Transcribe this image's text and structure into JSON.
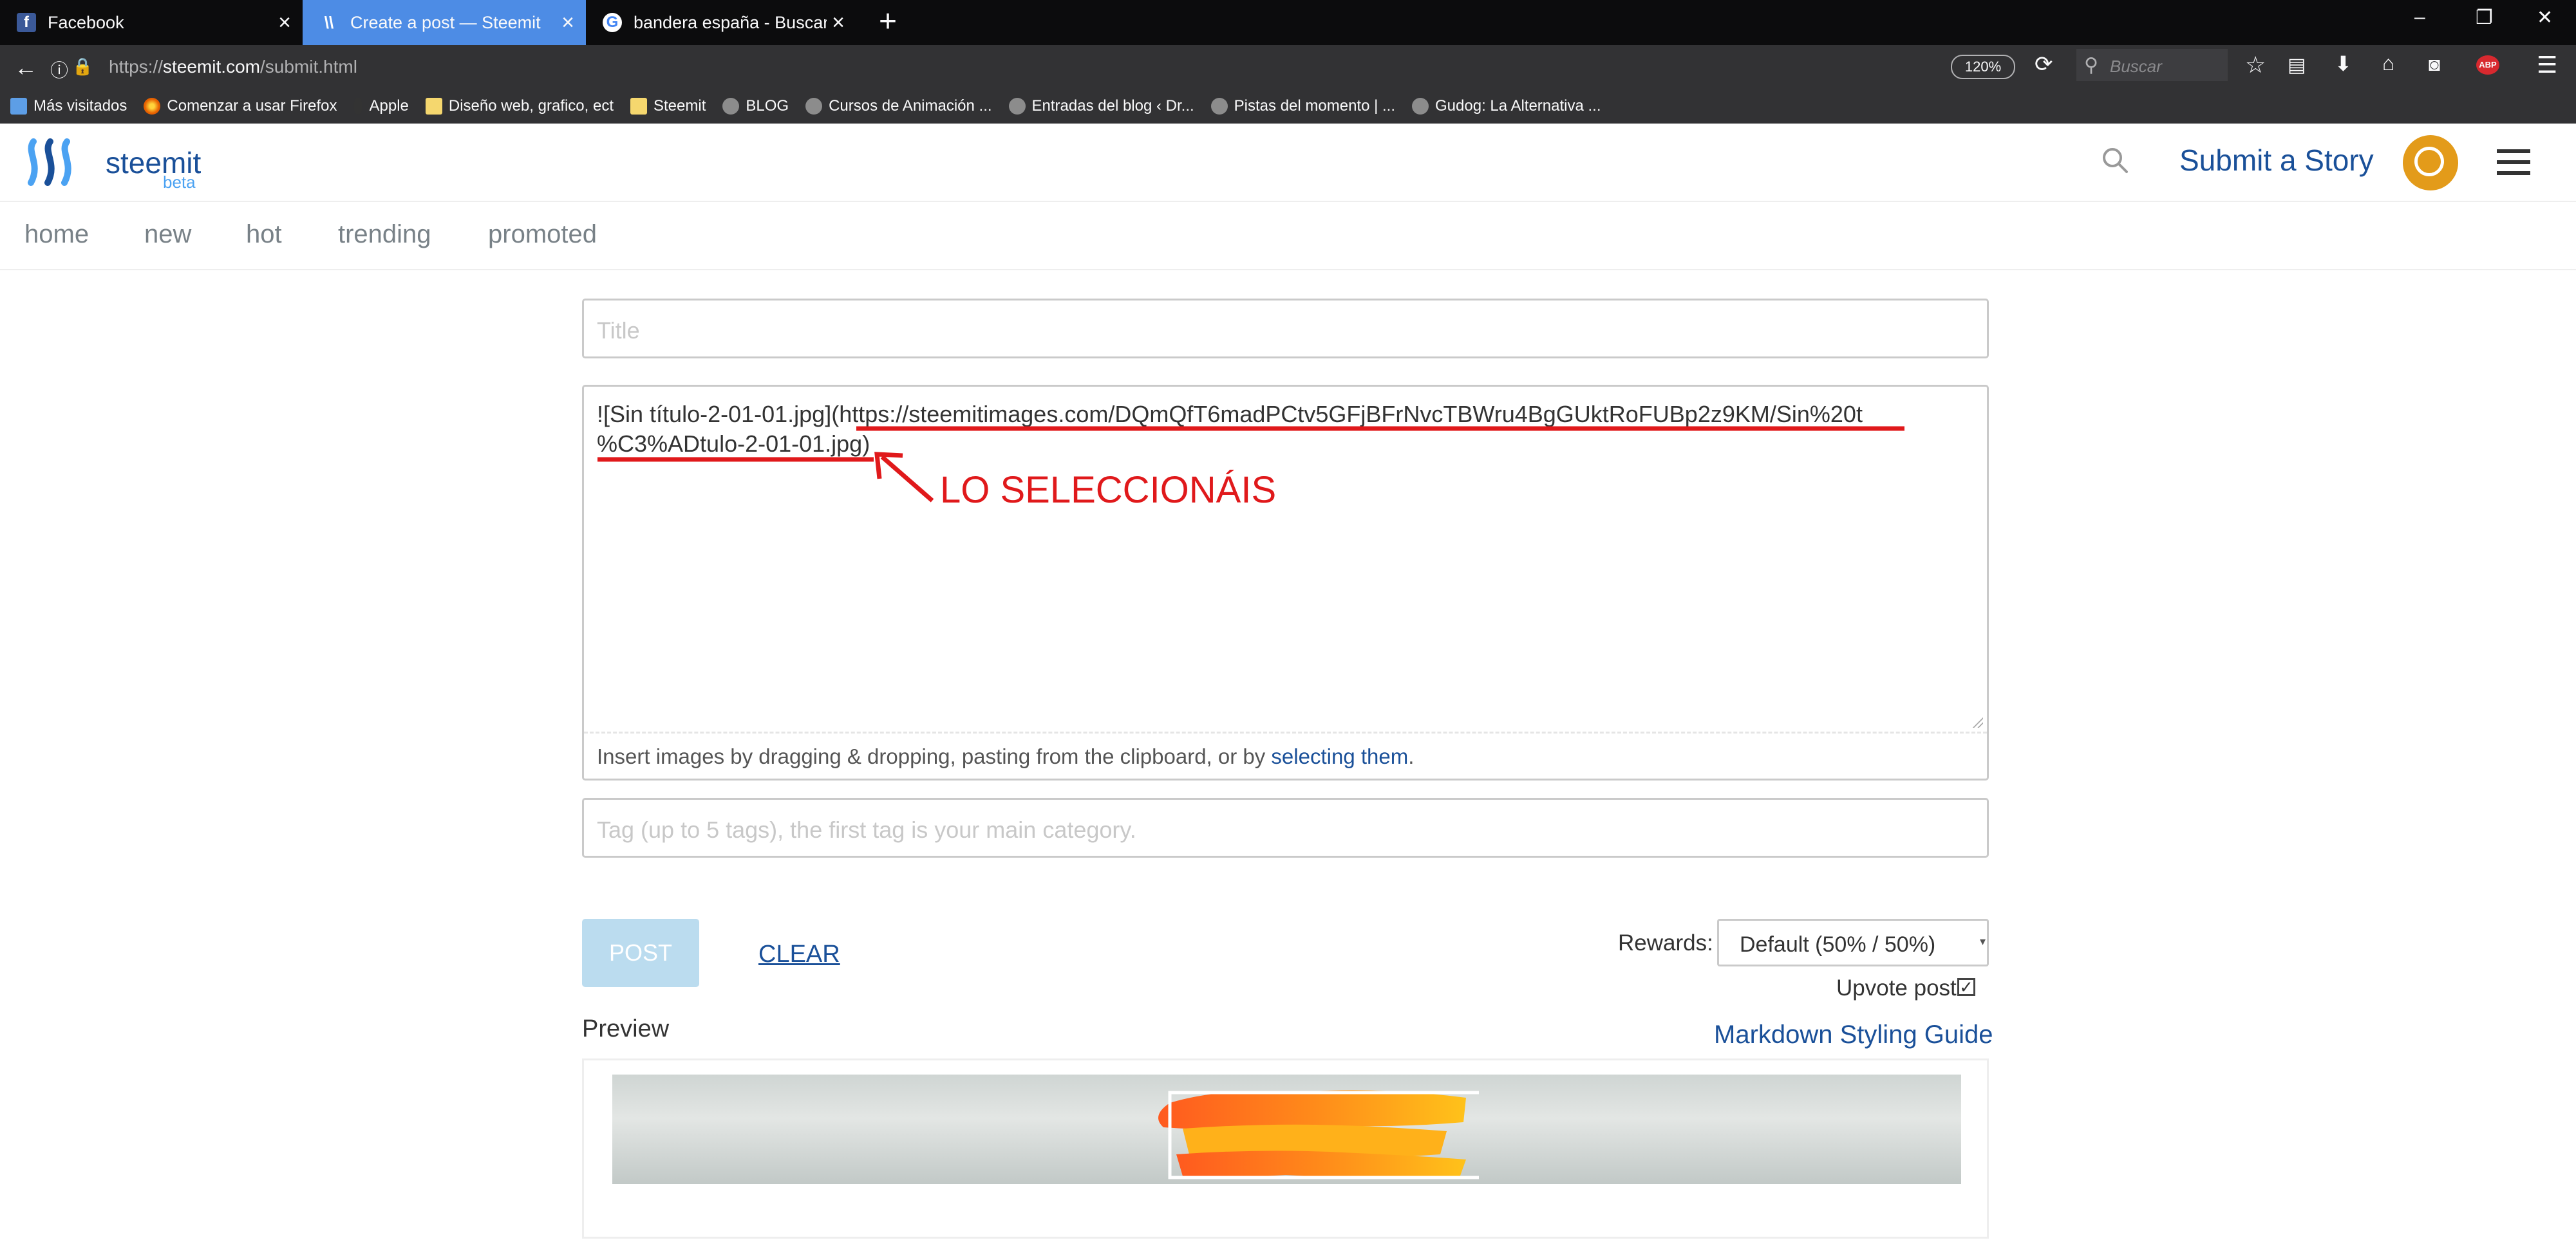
{
  "browser": {
    "tabs": [
      {
        "title": "Facebook",
        "icon": "facebook-icon",
        "active": false
      },
      {
        "title": "Create a post — Steemit",
        "icon": "steemit-icon",
        "active": true
      },
      {
        "title": "bandera españa - Buscar co",
        "icon": "google-icon",
        "active": false
      }
    ],
    "new_tab_glyph": "+",
    "window_controls": {
      "minimize": "–",
      "restore": "❐",
      "close": "✕"
    },
    "url_scheme": "https://",
    "url_host": "steemit.com",
    "url_path": "/submit.html",
    "zoom": "120%",
    "search_placeholder": "Buscar",
    "bookmarks": [
      {
        "label": "Más visitados",
        "icon": "bookmarks-folder-icon"
      },
      {
        "label": "Comenzar a usar Firefox",
        "icon": "firefox-icon"
      },
      {
        "label": "Apple",
        "icon": "apple-icon"
      },
      {
        "label": "Diseño web, grafico, ect",
        "icon": "folder-icon"
      },
      {
        "label": "Steemit",
        "icon": "folder-icon"
      },
      {
        "label": "BLOG",
        "icon": "globe-icon"
      },
      {
        "label": "Cursos de Animación ...",
        "icon": "globe-icon"
      },
      {
        "label": "Entradas del blog ‹ Dr...",
        "icon": "globe-icon"
      },
      {
        "label": "Pistas del momento | ...",
        "icon": "globe-icon"
      },
      {
        "label": "Gudog: La Alternativa ...",
        "icon": "globe-icon"
      }
    ]
  },
  "header": {
    "brand": "steemit",
    "beta": "beta",
    "submit_label": "Submit a Story",
    "colors": {
      "brand": "#1a5099",
      "beta": "#4ba2f2",
      "avatar": "#e39b1a"
    }
  },
  "subnav": {
    "items": [
      "home",
      "new",
      "hot",
      "trending",
      "promoted"
    ]
  },
  "editor": {
    "title_placeholder": "Title",
    "body_line1": "![Sin título-2-01-01.jpg](https://steemitimages.com/DQmQfT6madPCtv5GFjBFrNvcTBWru4BgGUktRoFUBp2z9KM/Sin%20t",
    "body_line2": "%C3%ADtulo-2-01-01.jpg)",
    "dropzone_text": "Insert images by dragging & dropping, pasting from the clipboard, or by ",
    "dropzone_link": "selecting them",
    "dropzone_end": ".",
    "tags_placeholder": "Tag (up to 5 tags), the first tag is your main category.",
    "annotation": "LO SELECCIONÁIS",
    "annotation_color": "#e0191b"
  },
  "actions": {
    "post_label": "POST",
    "clear_label": "CLEAR",
    "rewards_label": "Rewards:",
    "rewards_value": "Default (50% / 50%)",
    "upvote_label": "Upvote post",
    "upvote_checked": true,
    "upvote_mark": "✓"
  },
  "preview": {
    "title": "Preview",
    "markdown_link": "Markdown Styling Guide"
  }
}
